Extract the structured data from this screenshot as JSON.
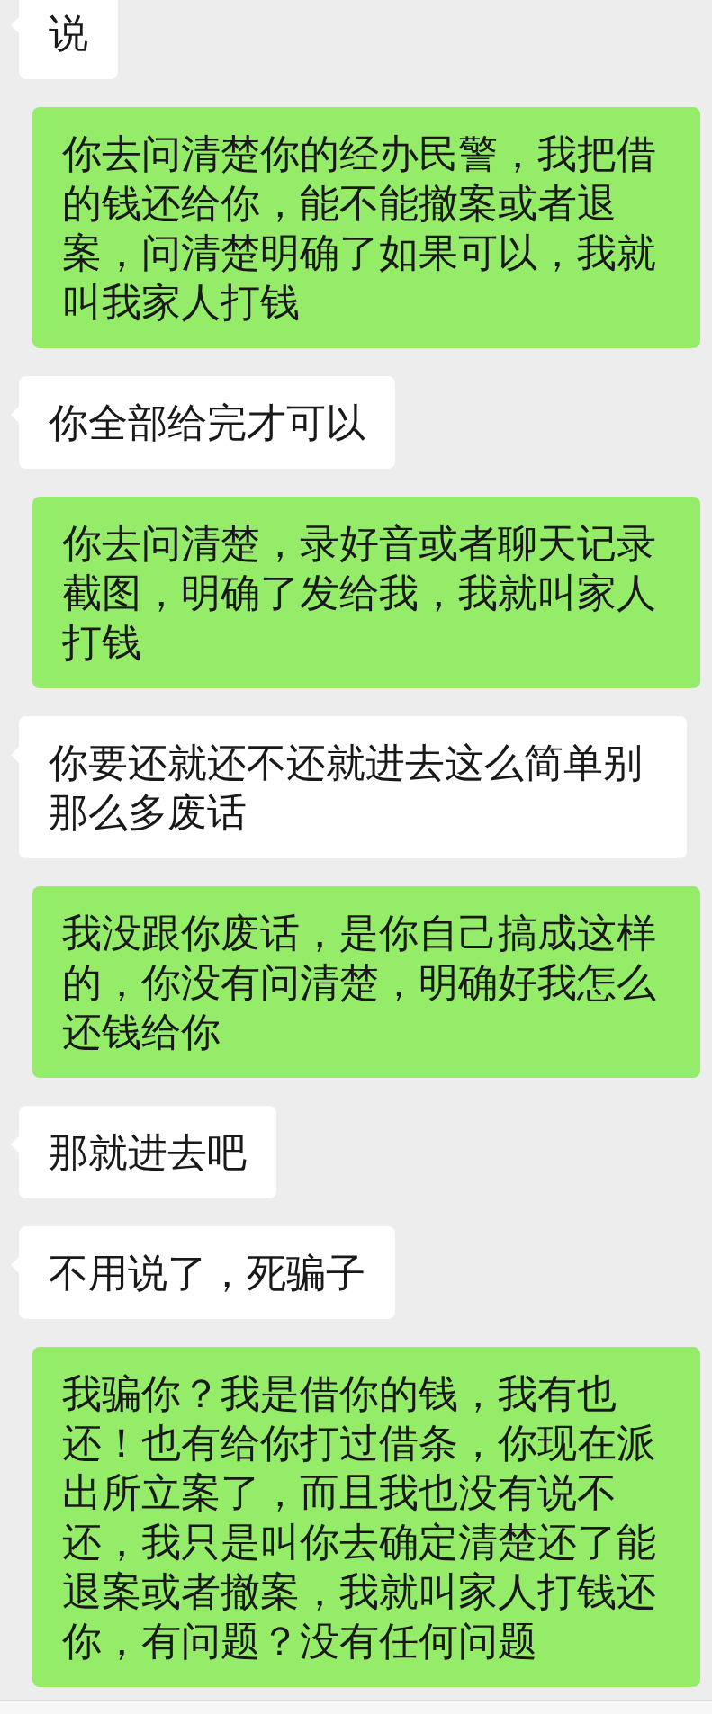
{
  "messages": [
    {
      "kind": "received",
      "text": "说"
    },
    {
      "kind": "sent",
      "text": "你去问清楚你的经办民警，我把借的钱还给你，能不能撤案或者退案，问清楚明确了如果可以，我就叫我家人打钱"
    },
    {
      "kind": "received",
      "text": "你全部给完才可以"
    },
    {
      "kind": "sent",
      "text": "你去问清楚，录好音或者聊天记录截图，明确了发给我，我就叫家人打钱"
    },
    {
      "kind": "received",
      "text": "你要还就还不还就进去这么简单别那么多废话"
    },
    {
      "kind": "sent",
      "text": "我没跟你废话，是你自己搞成这样的，你没有问清楚，明确好我怎么还钱给你"
    },
    {
      "kind": "received",
      "text": "那就进去吧"
    },
    {
      "kind": "received",
      "text": "不用说了，死骗子"
    },
    {
      "kind": "sent",
      "text": "我骗你？我是借你的钱，我有也还！也有给你打过借条，你现在派出所立案了，而且我也没有说不还，我只是叫你去确定清楚还了能退案或者撤案，我就叫家人打钱还你，有问题？没有任何问题"
    }
  ]
}
